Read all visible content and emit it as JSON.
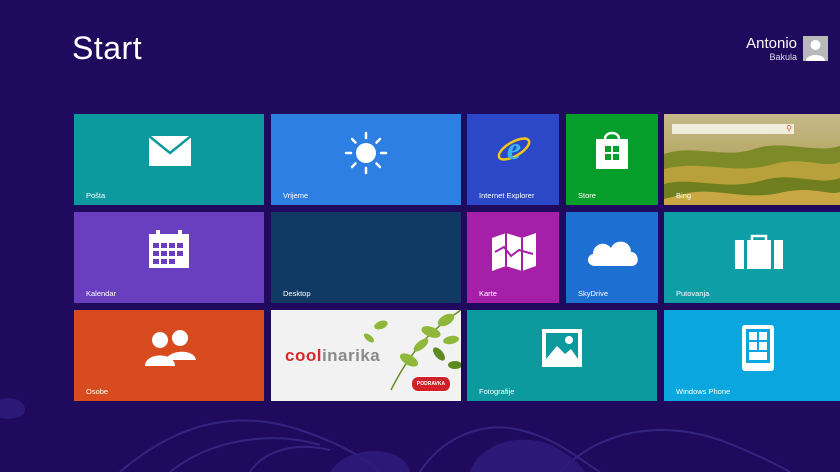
{
  "screen": {
    "title": "Start",
    "background_color": "#1f0a5e"
  },
  "user": {
    "first_name": "Antonio",
    "last_name": "Bakula",
    "avatar_icon": "user-avatar-icon"
  },
  "tiles": [
    {
      "id": "posta",
      "label": "Pošta",
      "color": "#0d9a9e",
      "icon": "mail-icon"
    },
    {
      "id": "vrijeme",
      "label": "Vrijeme",
      "color": "#2d7fe3",
      "icon": "sun-icon"
    },
    {
      "id": "ie",
      "label": "Internet Explorer",
      "color": "#2b48c9",
      "icon": "internet-explorer-icon"
    },
    {
      "id": "store",
      "label": "Store",
      "color": "#069e2b",
      "icon": "store-bag-icon"
    },
    {
      "id": "bing",
      "label": "Bing",
      "color": "#8a9a3a",
      "icon": "bing-landscape-image"
    },
    {
      "id": "kalendar",
      "label": "Kalendar",
      "color": "#6a3fbf",
      "icon": "calendar-icon"
    },
    {
      "id": "desktop",
      "label": "Desktop",
      "color": "#103a63",
      "icon": ""
    },
    {
      "id": "karte",
      "label": "Karte",
      "color": "#a51fa8",
      "icon": "map-icon"
    },
    {
      "id": "skydrive",
      "label": "SkyDrive",
      "color": "#1d6fd1",
      "icon": "cloud-icon"
    },
    {
      "id": "putovanja",
      "label": "Putovanja",
      "color": "#0e9ea6",
      "icon": "suitcase-icon"
    },
    {
      "id": "osobe",
      "label": "Osobe",
      "color": "#d84b1f",
      "icon": "people-icon"
    },
    {
      "id": "coolinarika",
      "label": "",
      "color": "#f2f2f2",
      "icon": "coolinarika-logo"
    },
    {
      "id": "fotografije",
      "label": "Fotografije",
      "color": "#0d9a9e",
      "icon": "photo-icon"
    },
    {
      "id": "windowsphone",
      "label": "Windows Phone",
      "color": "#0aa6e0",
      "icon": "phone-icon"
    }
  ],
  "coolinarika": {
    "wordmark_part1": "cool",
    "wordmark_part2": "inarika",
    "badge": "PODRAVKA"
  }
}
